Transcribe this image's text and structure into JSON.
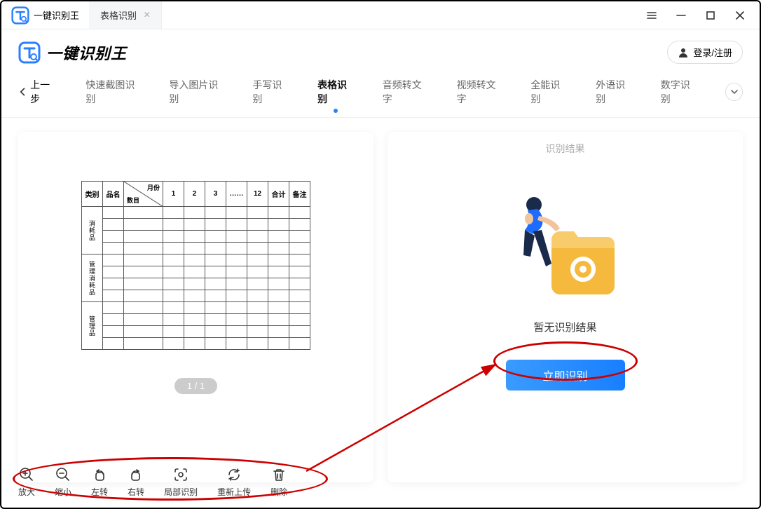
{
  "titlebar": {
    "app": "一键识别王",
    "tab": "表格识别"
  },
  "brand": "一键识别王",
  "login": "登录/注册",
  "back": "上一步",
  "nav": [
    "快速截图识别",
    "导入图片识别",
    "手写识别",
    "表格识别",
    "音频转文字",
    "视频转文字",
    "全能识别",
    "外语识别",
    "数字识别"
  ],
  "preview_table": {
    "diag_top": "月份",
    "diag_bottom": "数目",
    "cols_pre": [
      "类别",
      "品名"
    ],
    "cols": [
      "1",
      "2",
      "3",
      "……",
      "12",
      "合计",
      "备注"
    ],
    "row_groups": [
      "消耗品",
      "管理消耗品",
      "管理品"
    ]
  },
  "page_indicator": "1 / 1",
  "result": {
    "title": "识别结果",
    "empty": "暂无识别结果",
    "button": "立即识别"
  },
  "tools": [
    "放大",
    "缩小",
    "左转",
    "右转",
    "局部识别",
    "重新上传",
    "删除"
  ]
}
